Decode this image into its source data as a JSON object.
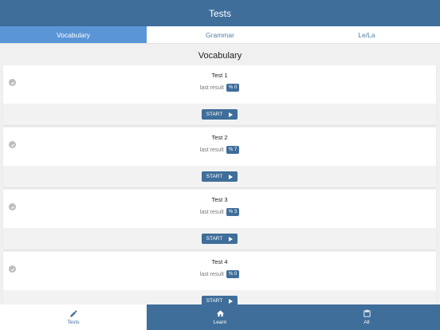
{
  "header": {
    "title": "Tests"
  },
  "tabs": [
    {
      "label": "Vocabulary",
      "active": true
    },
    {
      "label": "Grammar",
      "active": false
    },
    {
      "label": "Le/La",
      "active": false
    }
  ],
  "section": {
    "title": "Vocabulary"
  },
  "tests": [
    {
      "title": "Test 1",
      "result_label": "last result",
      "result": "% 0",
      "start_label": "START"
    },
    {
      "title": "Test 2",
      "result_label": "last result",
      "result": "% 7",
      "start_label": "START"
    },
    {
      "title": "Test 3",
      "result_label": "last result",
      "result": "% 3",
      "start_label": "START"
    },
    {
      "title": "Test 4",
      "result_label": "last result",
      "result": "% 0",
      "start_label": "START"
    }
  ],
  "bottom_nav": [
    {
      "label": "Tests",
      "icon": "pencil-icon",
      "active": true
    },
    {
      "label": "Learn",
      "icon": "home-icon",
      "active": false
    },
    {
      "label": "All",
      "icon": "clipboard-icon",
      "active": false
    }
  ],
  "colors": {
    "primary": "#3f6e9b",
    "active_tab": "#5a96d6",
    "check": "#bdbdbd"
  }
}
